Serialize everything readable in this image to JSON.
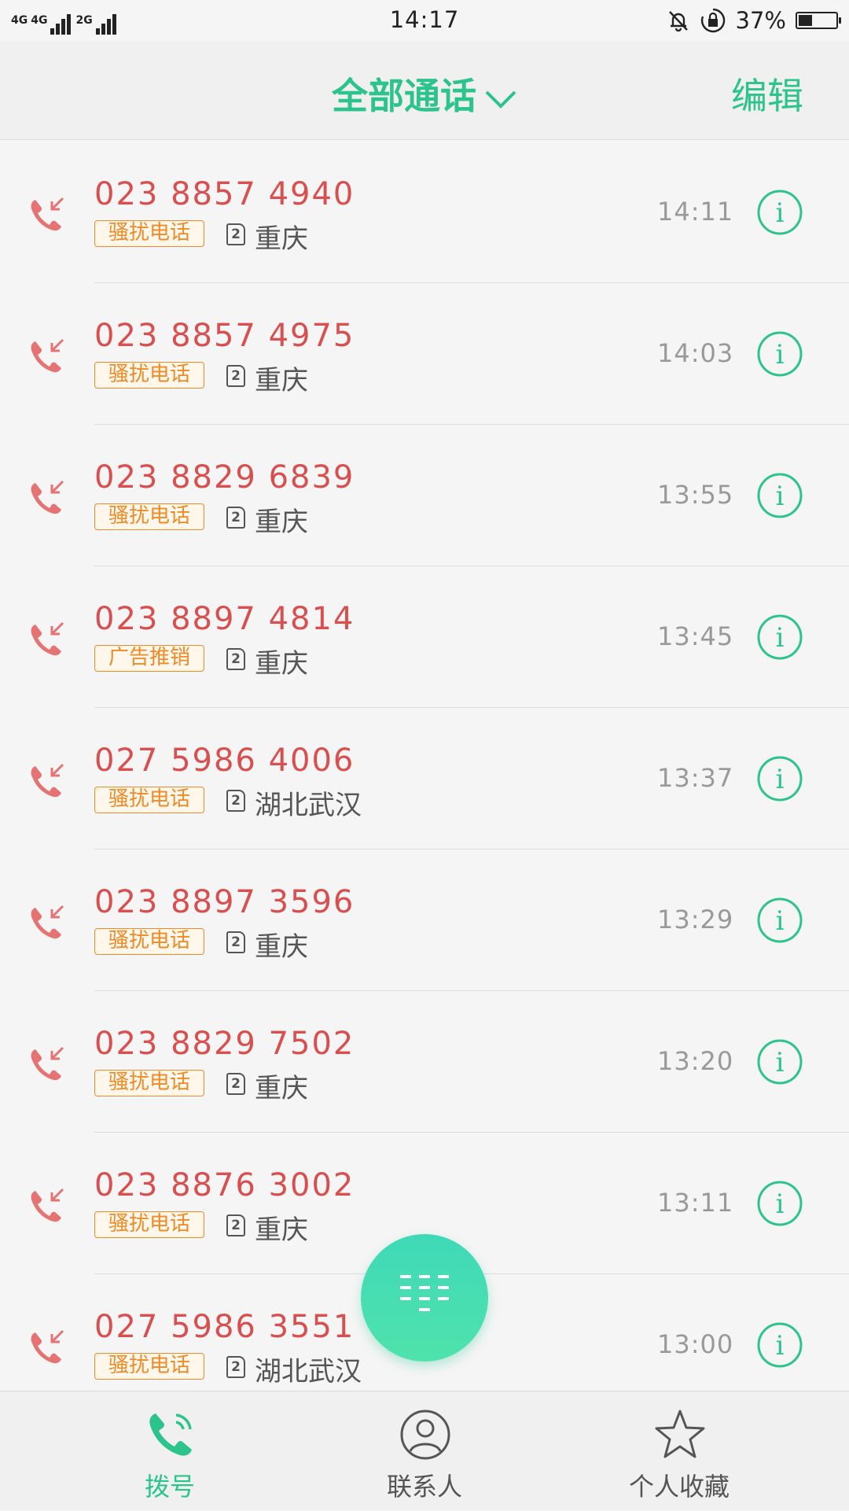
{
  "status_bar": {
    "network1": "4G",
    "network2": "2G",
    "time": "14:17",
    "battery_text": "37%",
    "battery_level": 0.37,
    "icons": [
      "mute-bell-icon",
      "rotation-lock-icon",
      "battery-icon"
    ]
  },
  "header": {
    "title": "全部通话",
    "edit_label": "编辑"
  },
  "colors": {
    "accent": "#2cc38d",
    "missed_call": "#d94f4f",
    "tag": "#f08a24",
    "secondary_text": "#999999"
  },
  "calls": [
    {
      "number": "023 8857 4940",
      "tag": "骚扰电话",
      "sim": "2",
      "location": "重庆",
      "time": "14:11"
    },
    {
      "number": "023 8857 4975",
      "tag": "骚扰电话",
      "sim": "2",
      "location": "重庆",
      "time": "14:03"
    },
    {
      "number": "023 8829 6839",
      "tag": "骚扰电话",
      "sim": "2",
      "location": "重庆",
      "time": "13:55"
    },
    {
      "number": "023 8897 4814",
      "tag": "广告推销",
      "sim": "2",
      "location": "重庆",
      "time": "13:45"
    },
    {
      "number": "027 5986 4006",
      "tag": "骚扰电话",
      "sim": "2",
      "location": "湖北武汉",
      "time": "13:37"
    },
    {
      "number": "023 8897 3596",
      "tag": "骚扰电话",
      "sim": "2",
      "location": "重庆",
      "time": "13:29"
    },
    {
      "number": "023 8829 7502",
      "tag": "骚扰电话",
      "sim": "2",
      "location": "重庆",
      "time": "13:20"
    },
    {
      "number": "023 8876 3002",
      "tag": "骚扰电话",
      "sim": "2",
      "location": "重庆",
      "time": "13:11"
    },
    {
      "number": "027 5986 3551",
      "tag": "骚扰电话",
      "sim": "2",
      "location": "湖北武汉",
      "time": "13:00"
    }
  ],
  "fab": {
    "icon": "dialpad-icon"
  },
  "bottom_nav": [
    {
      "label": "拨号",
      "icon": "phone-icon",
      "active": true
    },
    {
      "label": "联系人",
      "icon": "contact-icon",
      "active": false
    },
    {
      "label": "个人收藏",
      "icon": "star-icon",
      "active": false
    }
  ]
}
